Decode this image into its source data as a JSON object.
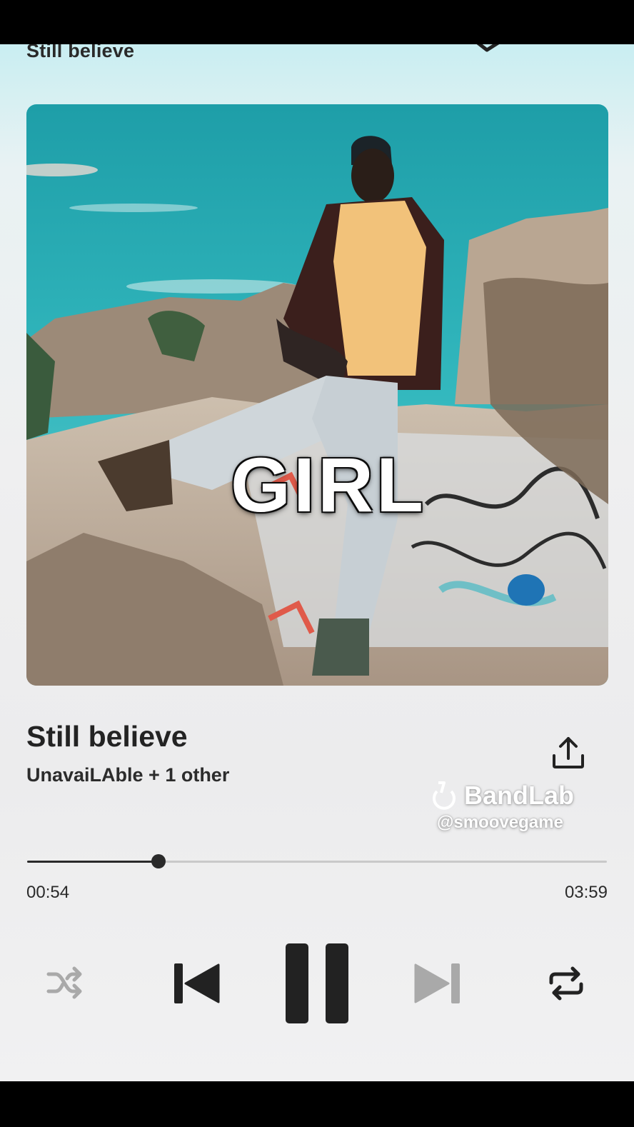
{
  "header": {
    "title": "Still believe"
  },
  "cover": {
    "overlay_text": "GIRL"
  },
  "track": {
    "title": "Still believe",
    "artist": "UnavaiLAble + 1 other"
  },
  "watermark": {
    "brand": "BandLab",
    "handle": "@smoovegame"
  },
  "playback": {
    "elapsed": "00:54",
    "total": "03:59",
    "progress": 0.226,
    "state": "playing"
  },
  "icons": [
    "collapse-icon",
    "share-icon",
    "shuffle-icon",
    "previous-icon",
    "pause-icon",
    "next-icon",
    "repeat-icon"
  ],
  "colors": {
    "accent": "#2a2a2a",
    "disabled": "#a9a9a9",
    "track": "#c9c9c9"
  }
}
